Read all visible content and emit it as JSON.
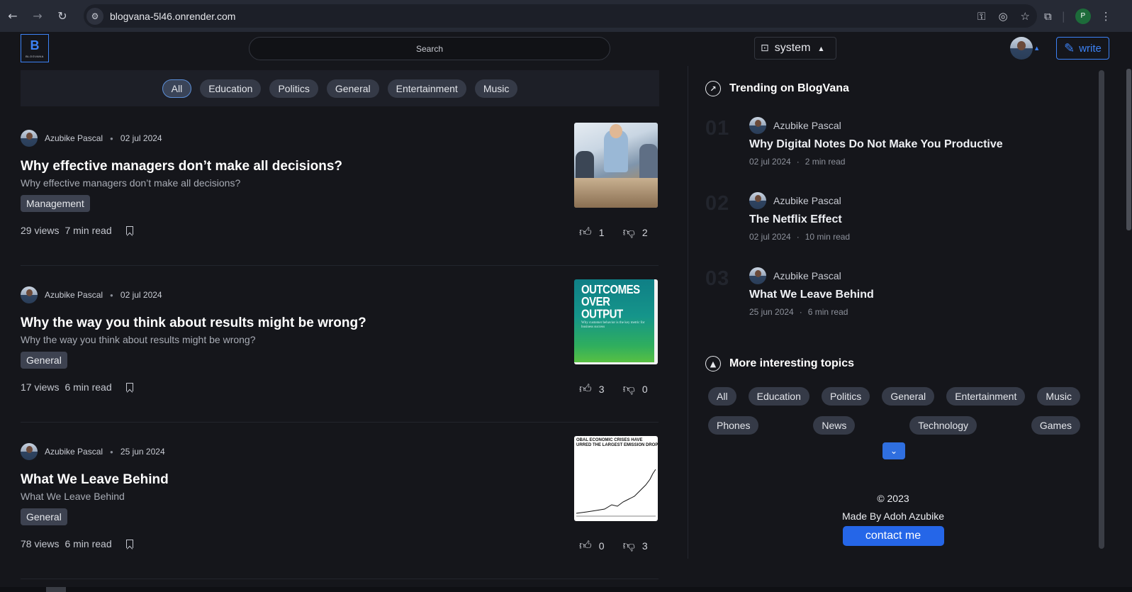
{
  "browser": {
    "url": "blogvana-5l46.onrender.com",
    "profile_initial": "P"
  },
  "header": {
    "logo_text": "BLOGVANA",
    "search_placeholder": "Search",
    "theme_label": "system",
    "write_label": "write"
  },
  "filters": [
    "All",
    "Education",
    "Politics",
    "General",
    "Entertainment",
    "Music"
  ],
  "posts": [
    {
      "author": "Azubike Pascal",
      "date": "02 jul 2024",
      "title": "Why effective managers don’t make all decisions?",
      "subtitle": "Why effective managers don’t make all decisions?",
      "tag": "Management",
      "views": "29 views",
      "read": "7 min read",
      "likes": "1",
      "dislikes": "2"
    },
    {
      "author": "Azubike Pascal",
      "date": "02 jul 2024",
      "title": "Why the way you think about results might be wrong?",
      "subtitle": "Why the way you think about results might be wrong?",
      "tag": "General",
      "views": "17 views",
      "read": "6 min read",
      "likes": "3",
      "dislikes": "0",
      "thumb_title": "OUTCOMES OVER OUTPUT",
      "thumb_sub": "Why customer behavior is the key metric for business success"
    },
    {
      "author": "Azubike Pascal",
      "date": "25 jun 2024",
      "title": "What We Leave Behind",
      "subtitle": "What We Leave Behind",
      "tag": "General",
      "views": "78 views",
      "read": "6 min read",
      "likes": "0",
      "dislikes": "3",
      "thumb_title": "OBAL ECONOMIC CRISES HAVE",
      "thumb_title2": "URRED THE LARGEST EMISSION DROP"
    }
  ],
  "trending": {
    "heading": "Trending on BlogVana",
    "items": [
      {
        "num": "01",
        "author": "Azubike Pascal",
        "title": "Why Digital Notes Do Not Make You Productive",
        "date": "02 jul 2024",
        "read": "2 min read"
      },
      {
        "num": "02",
        "author": "Azubike Pascal",
        "title": "The Netflix Effect",
        "date": "02 jul 2024",
        "read": "10 min read"
      },
      {
        "num": "03",
        "author": "Azubike Pascal",
        "title": "What We Leave Behind",
        "date": "25 jun 2024",
        "read": "6 min read"
      }
    ]
  },
  "topics": {
    "heading": "More interesting topics",
    "row1": [
      "All",
      "Education",
      "Politics",
      "General",
      "Entertainment",
      "Music"
    ],
    "row2": [
      "Phones",
      "News",
      "Technology",
      "Games"
    ]
  },
  "footer": {
    "copyright": "©  2023",
    "made_by": "Made By Adoh Azubike",
    "contact_label": "contact me"
  },
  "colors": {
    "accent": "#3c82f6",
    "background": "#15161b",
    "chip": "#353a47"
  }
}
